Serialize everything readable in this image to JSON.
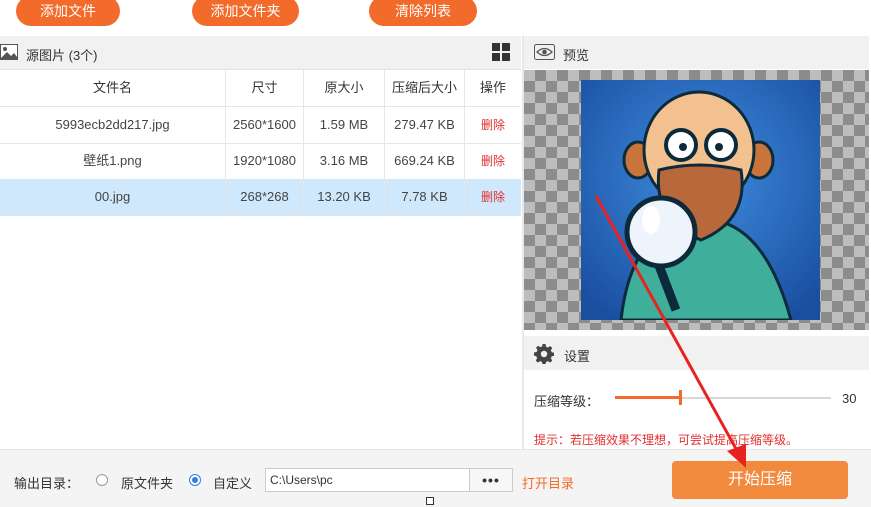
{
  "toolbar": {
    "add_file_label": "添加文件",
    "add_folder_label": "添加文件夹",
    "clear_list_label": "清除列表"
  },
  "source_panel": {
    "title": "源图片 (3个)",
    "icons": {
      "title": "image-icon",
      "view_toggle": "grid-icon"
    },
    "columns": [
      "文件名",
      "尺寸",
      "原大小",
      "压缩后大小",
      "操作"
    ],
    "rows": [
      {
        "name": "5993ecb2dd217.jpg",
        "size": "2560*1600",
        "original": "1.59 MB",
        "compressed": "279.47 KB",
        "action": "删除",
        "selected": false
      },
      {
        "name": "壁纸1.png",
        "size": "1920*1080",
        "original": "3.16 MB",
        "compressed": "669.24 KB",
        "action": "删除",
        "selected": false
      },
      {
        "name": "00.jpg",
        "size": "268*268",
        "original": "13.20 KB",
        "compressed": "7.78 KB",
        "action": "删除",
        "selected": true
      }
    ]
  },
  "preview_panel": {
    "title": "预览",
    "icon": "eye-icon"
  },
  "settings_panel": {
    "title": "设置",
    "icon": "gear-icon",
    "level_label": "压缩等级：",
    "level_value": "30",
    "level_fraction": 0.3,
    "tip": "提示：若压缩效果不理想，可尝试提高压缩等级。"
  },
  "output": {
    "label": "输出目录：",
    "option_original": "原文件夹",
    "option_custom": "自定义",
    "selected": "custom",
    "path_value": "C:\\Users\\pc",
    "browse_label": "•••",
    "open_dir_label": "打开目录"
  },
  "start_button_label": "开始压缩",
  "colors": {
    "accent": "#f26b2b",
    "selected_row": "#cfe8fb",
    "danger": "#e03030",
    "annotation": "#e8231f"
  }
}
